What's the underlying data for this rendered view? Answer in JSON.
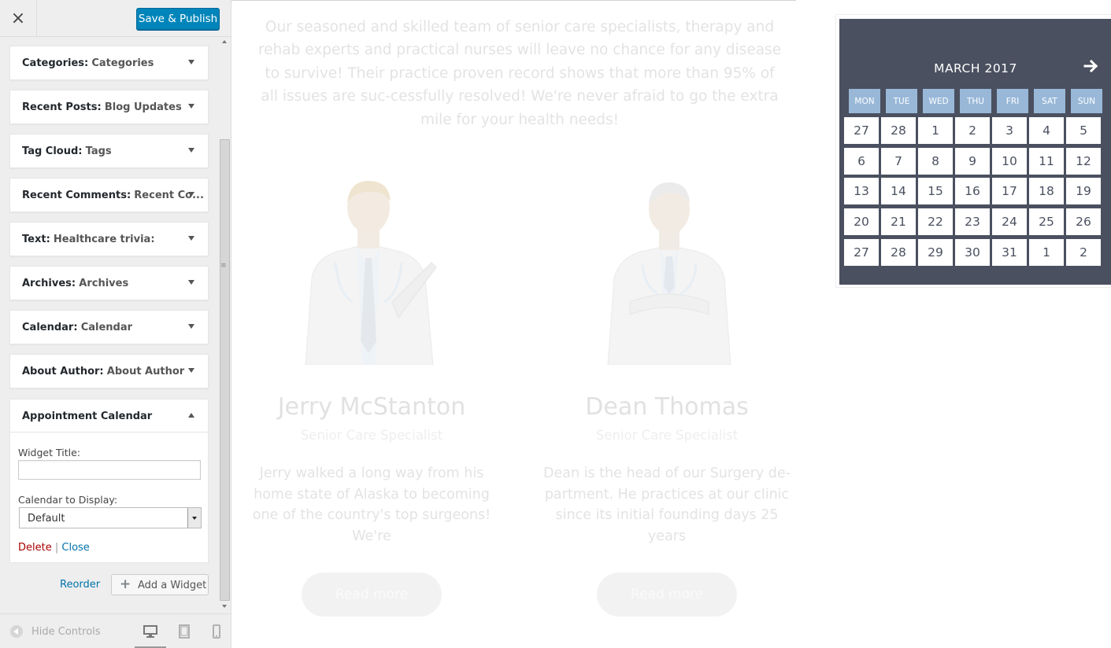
{
  "sidebar": {
    "close_label": "×",
    "save_label": "Save & Publish",
    "widgets": [
      {
        "type": "Categories",
        "title": "Categories"
      },
      {
        "type": "Recent Posts",
        "title": "Blog Updates"
      },
      {
        "type": "Tag Cloud",
        "title": "Tags"
      },
      {
        "type": "Recent Comments",
        "title": "Recent Co..."
      },
      {
        "type": "Text",
        "title": "Healthcare trivia:"
      },
      {
        "type": "Archives",
        "title": "Archives"
      },
      {
        "type": "Calendar",
        "title": "Calendar"
      },
      {
        "type": "About Author",
        "title": "About Author"
      }
    ],
    "appointment": {
      "title": "Appointment Calendar",
      "widget_title_label": "Widget Title:",
      "widget_title_value": "",
      "calendar_label": "Calendar to Display:",
      "calendar_value": "Default",
      "delete_label": "Delete",
      "separator": "|",
      "close_label": "Close"
    },
    "reorder_label": "Reorder",
    "add_widget_label": "Add a Widget",
    "footer": {
      "hide_controls_label": "Hide Controls"
    }
  },
  "preview": {
    "intro": "Our seasoned and skilled team of senior care specialists, therapy and rehab experts and practical nurses will leave no chance for any disease to survive! Their practice proven record shows that more than 95% of all issues are suc-cessfully resolved! We're never afraid to go the extra mile for your health needs!",
    "doctors": [
      {
        "name": "Jerry McStanton",
        "role": "Senior Care Specialist",
        "bio": "Jerry walked a long way from his home state of Alaska to becoming one of the country's top surgeons! We're",
        "button": "Read more"
      },
      {
        "name": "Dean Thomas",
        "role": "Senior Care Specialist",
        "bio": "Dean is the head of our Surgery de-partment. He practices at our clinic since its initial founding days 25 years",
        "button": "Read more"
      }
    ],
    "calendar": {
      "month": "MARCH 2017",
      "weekdays": [
        "MON",
        "TUE",
        "WED",
        "THU",
        "FRI",
        "SAT",
        "SUN"
      ],
      "weeks": [
        [
          "27",
          "28",
          "1",
          "2",
          "3",
          "4",
          "5"
        ],
        [
          "6",
          "7",
          "8",
          "9",
          "10",
          "11",
          "12"
        ],
        [
          "13",
          "14",
          "15",
          "16",
          "17",
          "18",
          "19"
        ],
        [
          "20",
          "21",
          "22",
          "23",
          "24",
          "25",
          "26"
        ],
        [
          "27",
          "28",
          "29",
          "30",
          "31",
          "1",
          "2"
        ]
      ],
      "colors": {
        "background": "#4a505f",
        "weekday_header": "#99b8d8",
        "day_cell": "#ffffff"
      }
    }
  }
}
